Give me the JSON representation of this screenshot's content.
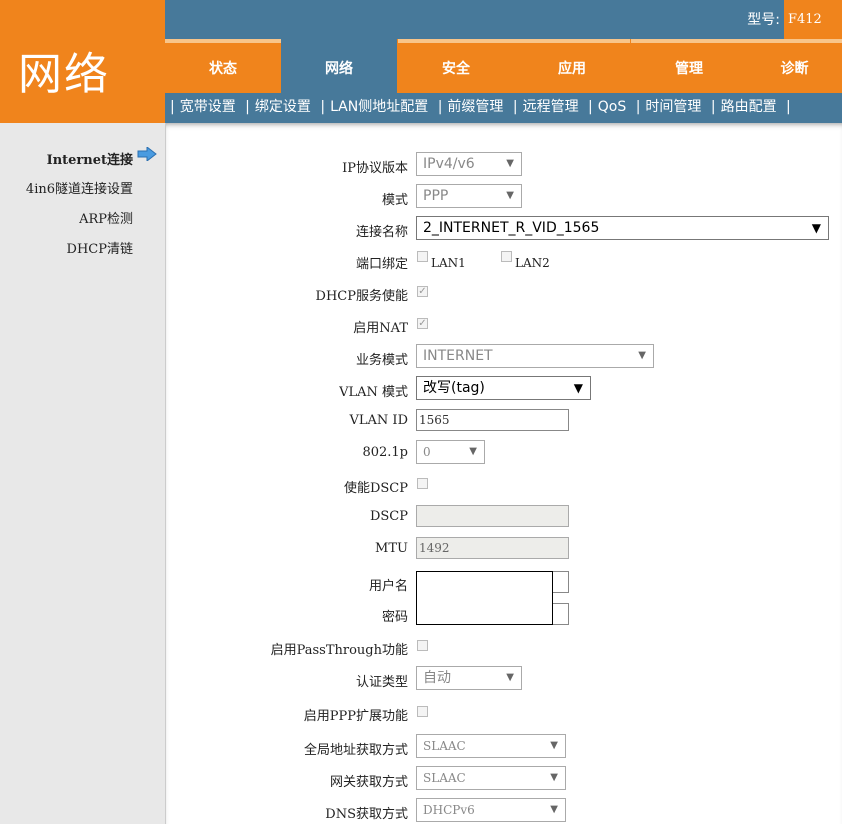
{
  "brand": {
    "title": "网络"
  },
  "header": {
    "model_label": "型号:",
    "model_value": "F412"
  },
  "tabs": [
    {
      "label": "状态",
      "active": false
    },
    {
      "label": "网络",
      "active": true
    },
    {
      "label": "安全",
      "active": false
    },
    {
      "label": "应用",
      "active": false
    },
    {
      "label": "管理",
      "active": false
    },
    {
      "label": "诊断",
      "active": false
    }
  ],
  "subnav": [
    "宽带设置",
    "绑定设置",
    "LAN侧地址配置",
    "前缀管理",
    "远程管理",
    "QoS",
    "时间管理",
    "路由配置"
  ],
  "sidebar": {
    "items": [
      "Internet连接",
      "4in6隧道连接设置",
      "ARP检测",
      "DHCP清链"
    ],
    "active_icon": "right-arrow-icon"
  },
  "form": {
    "ip_protocol": {
      "label": "IP协议版本",
      "value": "IPv4/v6"
    },
    "mode": {
      "label": "模式",
      "value": "PPP"
    },
    "connection_name": {
      "label": "连接名称",
      "value": "2_INTERNET_R_VID_1565"
    },
    "port_binding": {
      "label": "端口绑定",
      "lan1": "LAN1",
      "lan2": "LAN2",
      "lan1_checked": false,
      "lan2_checked": false
    },
    "dhcp_service": {
      "label": "DHCP服务使能",
      "checked": true
    },
    "nat": {
      "label": "启用NAT",
      "checked": true
    },
    "service_mode": {
      "label": "业务模式",
      "value": "INTERNET"
    },
    "vlan_mode": {
      "label": "VLAN 模式",
      "value": "改写(tag)"
    },
    "vlan_id": {
      "label": "VLAN ID",
      "value": "1565"
    },
    "dot1p": {
      "label": "802.1p",
      "value": "0"
    },
    "dscp_enable": {
      "label": "使能DSCP",
      "checked": false
    },
    "dscp": {
      "label": "DSCP",
      "value": ""
    },
    "mtu": {
      "label": "MTU",
      "value": "1492"
    },
    "username": {
      "label": "用户名",
      "value": ""
    },
    "password": {
      "label": "密码",
      "value": ""
    },
    "passthrough": {
      "label": "启用PassThrough功能",
      "checked": false
    },
    "auth_type": {
      "label": "认证类型",
      "value": "自动"
    },
    "ppp_ext": {
      "label": "启用PPP扩展功能",
      "checked": false
    },
    "global_addr": {
      "label": "全局地址获取方式",
      "value": "SLAAC"
    },
    "gateway": {
      "label": "网关获取方式",
      "value": "SLAAC"
    },
    "dns": {
      "label": "DNS获取方式",
      "value": "DHCPv6"
    }
  },
  "colors": {
    "orange": "#f0841c",
    "blue": "#47799a",
    "sidebar": "#e8e8e8"
  }
}
